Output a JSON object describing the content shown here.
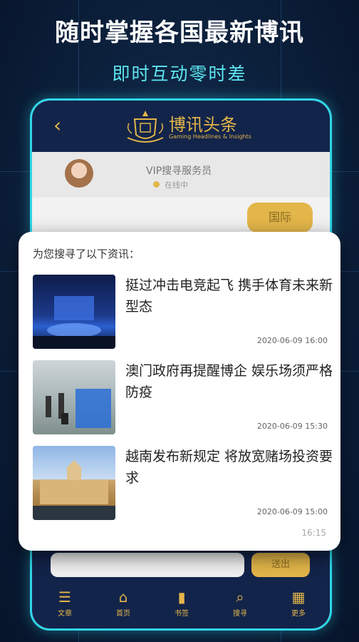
{
  "promo": {
    "headline": "随时掌握各国最新博讯",
    "subline": "即时互动零时差"
  },
  "app": {
    "title": "博讯头条",
    "tagline": "Gaming Headlines & Insights",
    "back_icon": "chevron-left-icon"
  },
  "agent": {
    "name": "VIP搜寻服务员",
    "status": "在线中"
  },
  "chip": {
    "label": "国际"
  },
  "results": {
    "intro": "为您搜寻了以下资讯：",
    "items": [
      {
        "title": "挺过冲击电竞起飞 携手体育未来新型态",
        "time": "2020-06-09 16:00"
      },
      {
        "title": "澳门政府再提醒博企 娱乐场须严格防疫",
        "time": "2020-06-09 15:30"
      },
      {
        "title": "越南发布新规定 将放宽赌场投资要求",
        "time": "2020-06-09 15:00"
      }
    ],
    "message_time": "16:15"
  },
  "composer": {
    "send_label": "送出"
  },
  "tabs": [
    {
      "label": "文章",
      "icon": "list-icon"
    },
    {
      "label": "首页",
      "icon": "home-icon"
    },
    {
      "label": "书签",
      "icon": "bookmark-icon"
    },
    {
      "label": "搜寻",
      "icon": "search-icon"
    },
    {
      "label": "更多",
      "icon": "grid-icon"
    }
  ],
  "colors": {
    "accent_gold": "#e3b64a",
    "cyan": "#2fd6e8",
    "navy": "#13244a"
  }
}
